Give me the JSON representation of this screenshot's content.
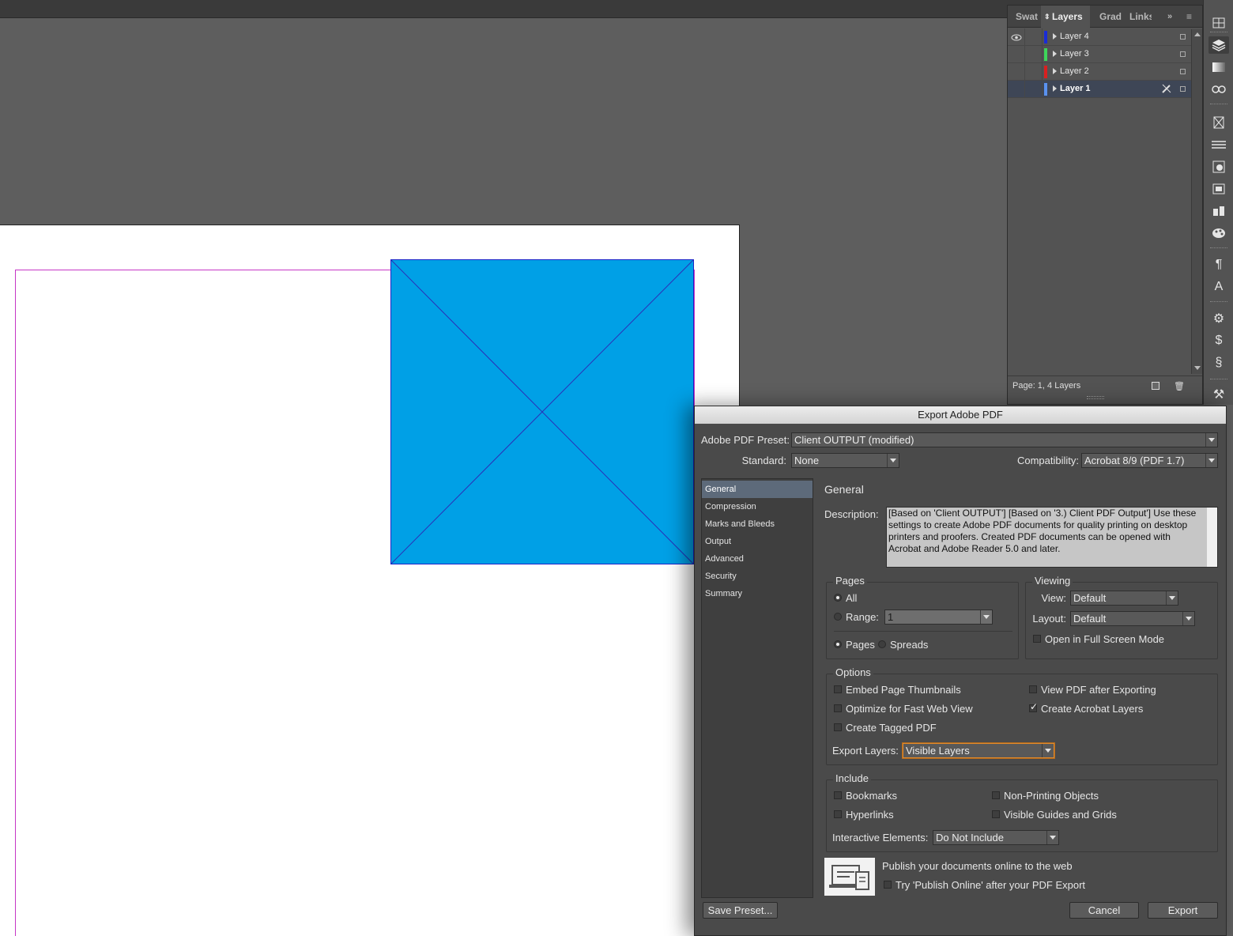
{
  "layers_panel": {
    "tabs": [
      "Swat",
      "Layers",
      "Grad",
      "Links"
    ],
    "layers": [
      {
        "name": "Layer 4",
        "color": "#1a2cd6",
        "visible": true,
        "selected": false
      },
      {
        "name": "Layer 3",
        "color": "#3ed65a",
        "visible": false,
        "selected": false
      },
      {
        "name": "Layer 2",
        "color": "#d92020",
        "visible": false,
        "selected": false
      },
      {
        "name": "Layer 1",
        "color": "#5a92f0",
        "visible": false,
        "selected": true
      }
    ],
    "status": "Page: 1, 4 Layers"
  },
  "dialog": {
    "title": "Export Adobe PDF",
    "preset_label": "Adobe PDF Preset:",
    "preset_value": "Client OUTPUT (modified)",
    "standard_label": "Standard:",
    "standard_value": "None",
    "compat_label": "Compatibility:",
    "compat_value": "Acrobat 8/9 (PDF 1.7)",
    "nav": [
      "General",
      "Compression",
      "Marks and Bleeds",
      "Output",
      "Advanced",
      "Security",
      "Summary"
    ],
    "section_title": "General",
    "description_label": "Description:",
    "description": "[Based on 'Client OUTPUT'] [Based on '3.) Client PDF Output'] Use these settings to create Adobe PDF documents for quality printing on desktop printers and proofers.  Created PDF documents can be opened with Acrobat and Adobe Reader 5.0 and later.",
    "pages": {
      "title": "Pages",
      "all_label": "All",
      "range_label": "Range:",
      "range_value": "1",
      "pages_label": "Pages",
      "spreads_label": "Spreads"
    },
    "viewing": {
      "title": "Viewing",
      "view_label": "View:",
      "view_value": "Default",
      "layout_label": "Layout:",
      "layout_value": "Default",
      "fullscreen_label": "Open in Full Screen Mode"
    },
    "options": {
      "title": "Options",
      "embed_thumbs": "Embed Page Thumbnails",
      "optimize_web": "Optimize for Fast Web View",
      "tagged_pdf": "Create Tagged PDF",
      "view_after": "View PDF after Exporting",
      "acrobat_layers": "Create Acrobat Layers",
      "export_layers_label": "Export Layers:",
      "export_layers_value": "Visible Layers"
    },
    "include": {
      "title": "Include",
      "bookmarks": "Bookmarks",
      "hyperlinks": "Hyperlinks",
      "non_printing": "Non-Printing Objects",
      "guides_grids": "Visible Guides and Grids",
      "interactive_label": "Interactive Elements:",
      "interactive_value": "Do Not Include"
    },
    "publish": {
      "heading": "Publish your documents online to the web",
      "try_label": "Try 'Publish Online' after your PDF Export"
    },
    "buttons": {
      "save_preset": "Save Preset...",
      "cancel": "Cancel",
      "export": "Export"
    }
  },
  "colors": {
    "frame_fill": "#00a0e6",
    "margin_guide": "#c636c6",
    "selection": "#5d6a7a"
  }
}
